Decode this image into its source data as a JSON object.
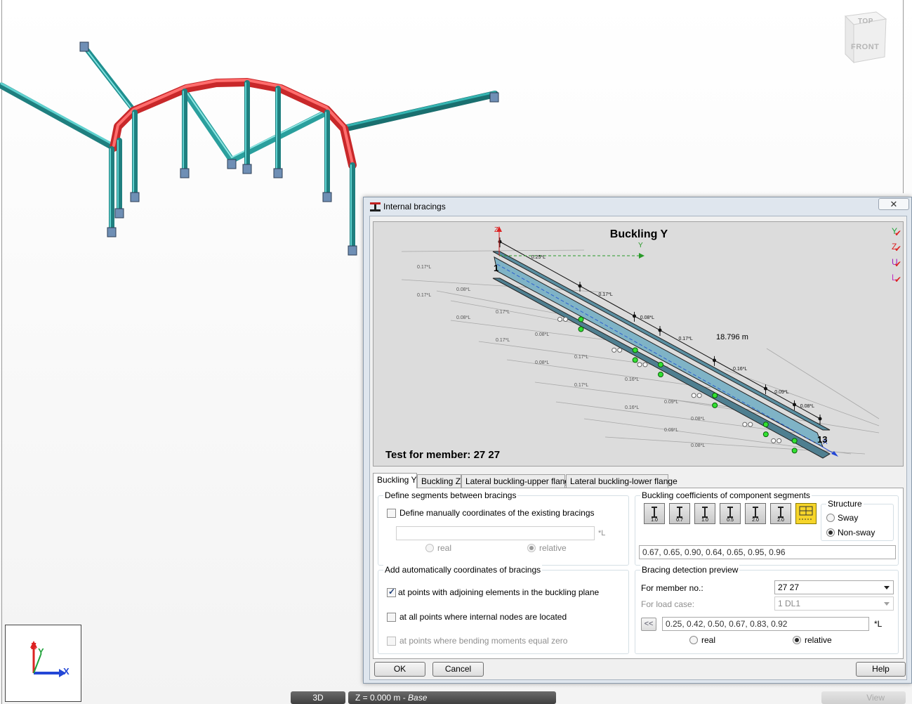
{
  "viewport": {
    "navcube": {
      "top_label": "TOP",
      "front_label": "FRONT"
    },
    "axis": {
      "z": "Z",
      "y": "Y",
      "x": "X"
    },
    "status": {
      "mode": "3D",
      "plane_prefix": "Z = 0.000 m - ",
      "plane_name": "Base",
      "view_label": "View"
    },
    "colors": {
      "member": "#2aa0a0",
      "highlight": "#e83a3a",
      "support": "#6f8fb5"
    }
  },
  "dialog": {
    "title": "Internal bracings",
    "close": "✕",
    "preview": {
      "title": "Buckling Y",
      "test_label": "Test for member: 27 27",
      "axis_z": "Z",
      "axis_y": "Y",
      "axis_x": "X",
      "node_start": "1",
      "node_end": "13",
      "length": "18.796  m",
      "upper_dims": [
        "0.25*L",
        "0.17*L",
        "0.08*L",
        "0.17*L",
        "0.16*L",
        "0.09*L",
        "0.08*L"
      ],
      "lower_dims": [
        "0.17*L",
        "0.17*L",
        "0.08*L",
        "0.08*L",
        "0.17*L",
        "0.17*L",
        "0.08*L",
        "0.08*L",
        "0.17*L",
        "0.17*L",
        "0.16*L",
        "0.16*L",
        "0.09*L",
        "0.09*L",
        "0.08*L",
        "0.08*L"
      ],
      "checks": [
        "Y",
        "Z",
        "U",
        "L"
      ]
    },
    "tabs": [
      "Buckling Y",
      "Buckling Z",
      "Lateral buckling-upper flange",
      "Lateral buckling-lower flange"
    ],
    "segments": {
      "title": "Define segments between bracings",
      "manual_label": "Define manually coordinates of the existing bracings",
      "coord_value": "",
      "unit": "*L",
      "real": "real",
      "relative": "relative"
    },
    "auto": {
      "title": "Add automatically coordinates of bracings",
      "opt1": "at points with adjoining elements in the buckling plane",
      "opt2": "at all points where internal nodes are located",
      "opt3": "at points where bending moments equal zero"
    },
    "coefficients": {
      "title": "Buckling coefficients of component segments",
      "buttons": [
        "1.0",
        "0.7",
        "1.0",
        "0.5",
        "2.0",
        "2.0",
        ""
      ],
      "value": "0.67, 0.65, 0.90, 0.64, 0.65, 0.95, 0.96"
    },
    "structure": {
      "title": "Structure",
      "sway": "Sway",
      "nonsway": "Non-sway"
    },
    "detection": {
      "title": "Bracing detection preview",
      "member_label": "For member no.:",
      "member_value": "27  27",
      "loadcase_label": "For load case:",
      "loadcase_value": "1  DL1",
      "back": "<<",
      "coords": "0.25, 0.42, 0.50, 0.67, 0.83, 0.92",
      "unit": "*L",
      "real": "real",
      "relative": "relative"
    },
    "buttons": {
      "ok": "OK",
      "cancel": "Cancel",
      "help": "Help"
    }
  }
}
